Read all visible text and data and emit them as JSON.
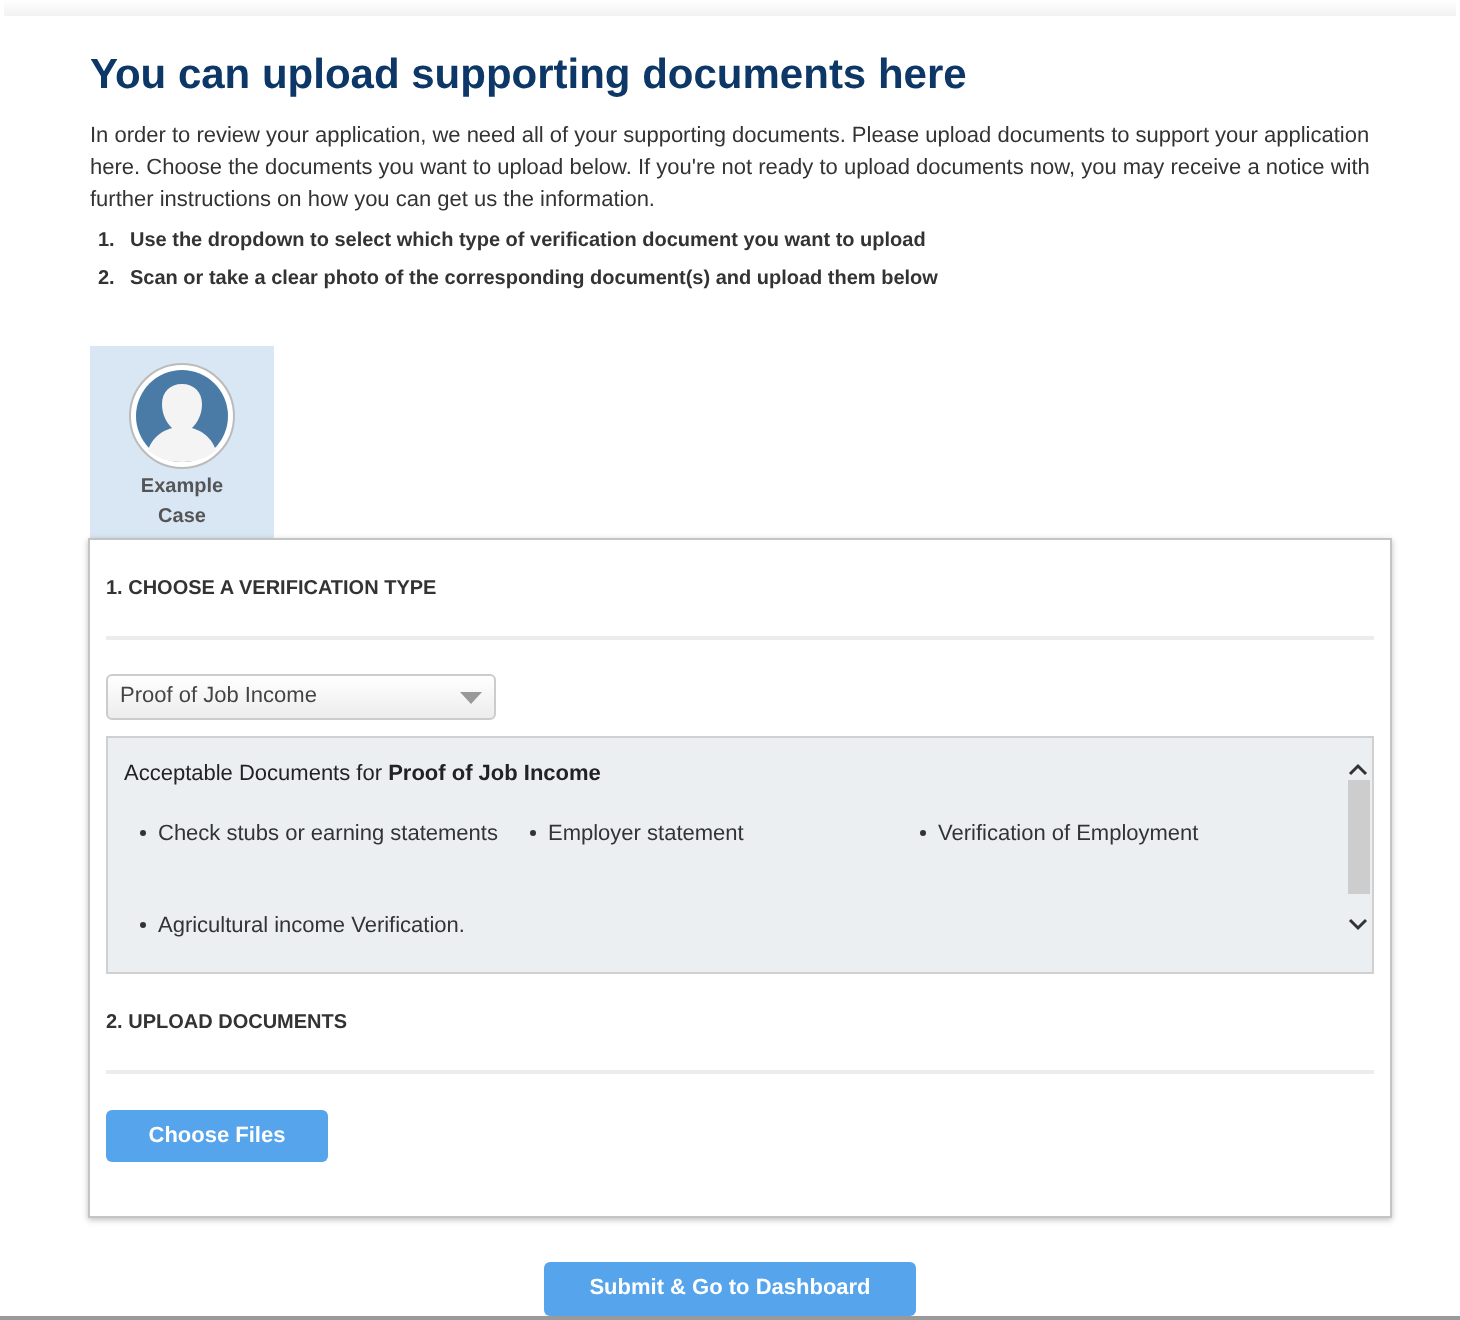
{
  "heading": "You can upload supporting documents here",
  "intro": "In order to review your application, we need all of your supporting documents. Please upload documents to support your application here. Choose the documents you want to upload below. If you're not ready to upload documents now, you may receive a notice with further instructions on how you can get us the information.",
  "steps": [
    "Use the dropdown to select which type of verification document you want to upload",
    "Scan or take a clear photo of the corresponding document(s) and upload them below"
  ],
  "step_numbers": [
    "1.",
    "2."
  ],
  "tabs": [
    {
      "label": "Example Case",
      "selected": true
    }
  ],
  "section_1": {
    "title": "1. CHOOSE A VERIFICATION TYPE",
    "dropdown": {
      "value": "Proof of Job Income"
    },
    "documents": {
      "caption": "Acceptable Documents for **Proof of Job Income**",
      "items": [
        "Check stubs or earning statements",
        "Employer statement",
        "Verification of Employment",
        "Agricultural income Verification."
      ]
    }
  },
  "section_2": {
    "title": "2. UPLOAD DOCUMENTS",
    "button": "Choose Files"
  },
  "submit_button": "Submit & Go to Dashboard"
}
